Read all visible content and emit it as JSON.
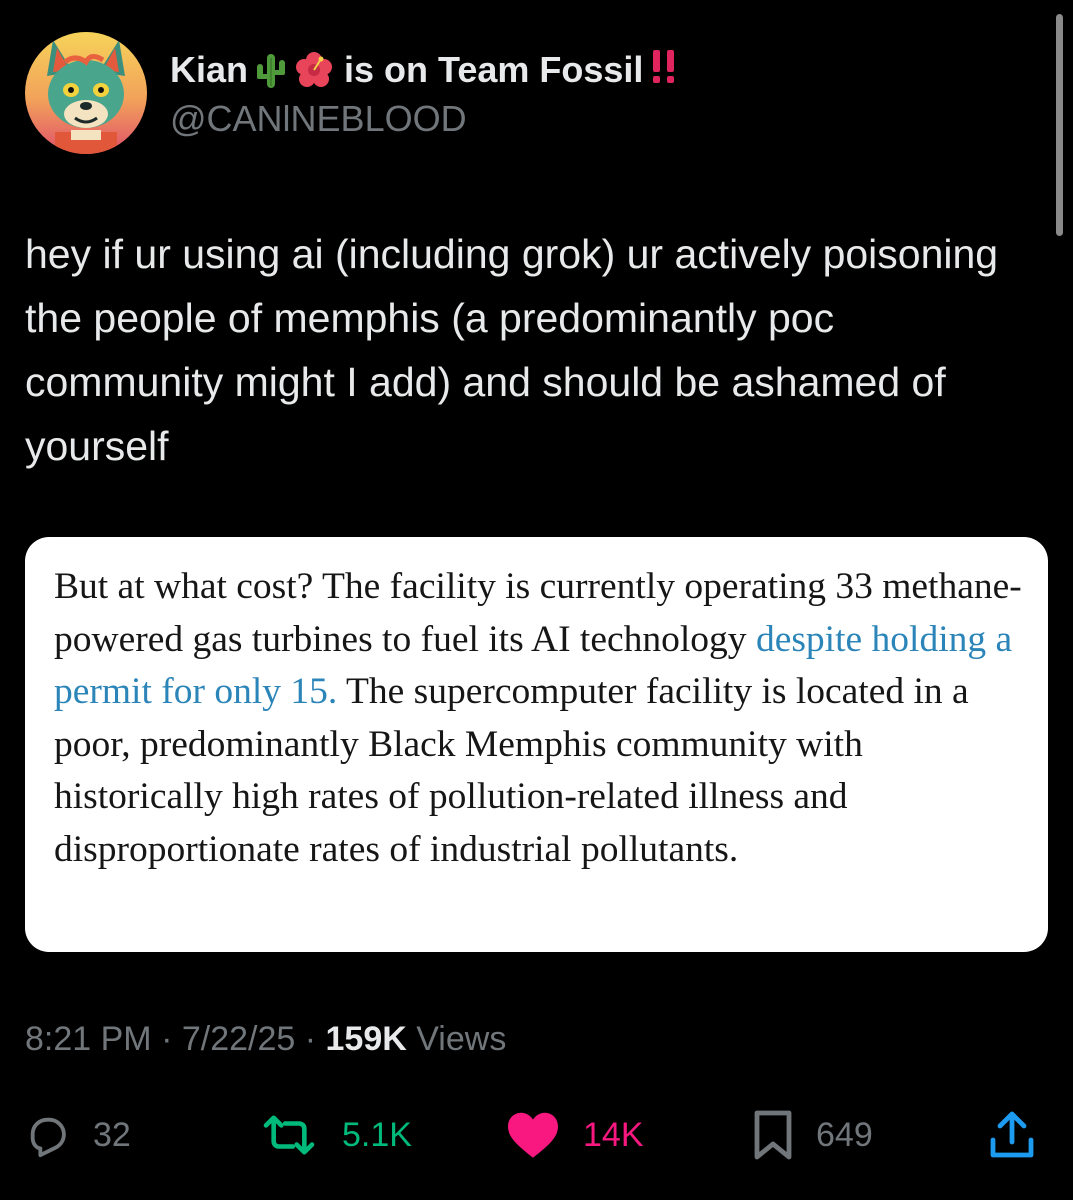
{
  "author": {
    "display_name": "Kian",
    "status_text": "is on Team Fossil",
    "bang": "‼️",
    "handle": "@CANlNEBLOOD",
    "emojis": [
      "cactus-icon",
      "hibiscus-icon"
    ]
  },
  "tweet": {
    "text": "hey if ur using ai (including grok) ur actively poisoning the people of memphis (a predominantly poc community might I add) and should be ashamed of yourself"
  },
  "quote": {
    "text_before": "But at what cost? The facility is currently operating 33 methane-powered gas turbines to fuel its AI technology ",
    "link_text": "despite holding a permit for only 15.",
    "text_after": " The supercomputer facility is located in a poor, predominantly Black Memphis community with historically high rates of pollution-related illness and disproportionate rates of industrial pollutants."
  },
  "meta": {
    "time": "8:21 PM",
    "separator": " · ",
    "date": "7/22/25",
    "views_count": "159K",
    "views_label": " Views"
  },
  "actions": {
    "replies": "32",
    "retweets": "5.1K",
    "likes": "14K",
    "bookmarks": "649"
  },
  "colors": {
    "background": "#000000",
    "primary_text": "#e7e9ea",
    "secondary_text": "#71767b",
    "retweet": "#00ba7c",
    "like": "#f91880",
    "link": "#2c85b8",
    "quote_background": "#ffffff",
    "bang": "#e0245e"
  }
}
